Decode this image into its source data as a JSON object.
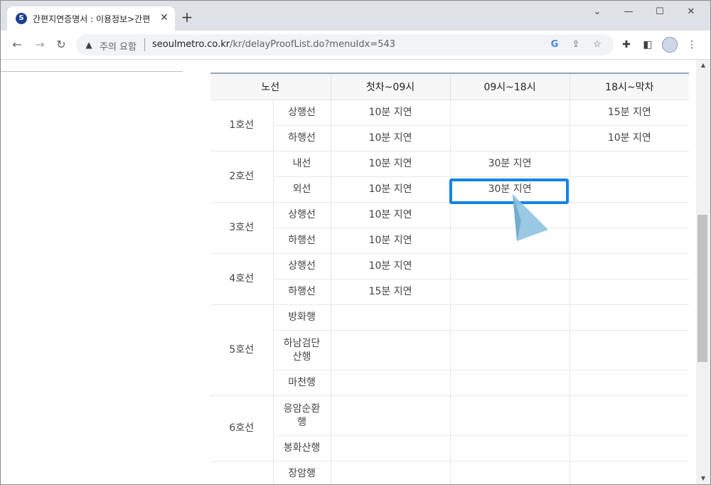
{
  "browser": {
    "tab_title": "간편지연증명서 : 이용정보>간편",
    "favicon_letter": "S",
    "new_tab": "+",
    "close_tab": "✕",
    "window_min": "—",
    "window_max": "☐",
    "window_close": "✕",
    "window_menu": "⌄",
    "security_warning": "주의 요함",
    "url_host": "seoulmetro.co.kr",
    "url_path": "/kr/delayProofList.do?menuIdx=543"
  },
  "table": {
    "headers": [
      "노선",
      "첫차~09시",
      "09시~18시",
      "18시~막차"
    ],
    "groups": [
      {
        "line": "1호선",
        "rows": [
          {
            "dir": "상행선",
            "c1": "10분 지연",
            "c2": "",
            "c3": "15분 지연"
          },
          {
            "dir": "하행선",
            "c1": "10분 지연",
            "c2": "",
            "c3": "10분 지연"
          }
        ]
      },
      {
        "line": "2호선",
        "rows": [
          {
            "dir": "내선",
            "c1": "10분 지연",
            "c2": "30분 지연",
            "c3": ""
          },
          {
            "dir": "외선",
            "c1": "10분 지연",
            "c2": "30분 지연",
            "c3": ""
          }
        ]
      },
      {
        "line": "3호선",
        "rows": [
          {
            "dir": "상행선",
            "c1": "10분 지연",
            "c2": "",
            "c3": ""
          },
          {
            "dir": "하행선",
            "c1": "10분 지연",
            "c2": "",
            "c3": ""
          }
        ]
      },
      {
        "line": "4호선",
        "rows": [
          {
            "dir": "상행선",
            "c1": "10분 지연",
            "c2": "",
            "c3": ""
          },
          {
            "dir": "하행선",
            "c1": "15분 지연",
            "c2": "",
            "c3": ""
          }
        ]
      },
      {
        "line": "5호선",
        "rows": [
          {
            "dir": "방화행",
            "c1": "",
            "c2": "",
            "c3": ""
          },
          {
            "dir": "하남검단\n산행",
            "c1": "",
            "c2": "",
            "c3": ""
          },
          {
            "dir": "마천행",
            "c1": "",
            "c2": "",
            "c3": ""
          }
        ]
      },
      {
        "line": "6호선",
        "rows": [
          {
            "dir": "응암순환\n행",
            "c1": "",
            "c2": "",
            "c3": ""
          },
          {
            "dir": "봉화산행",
            "c1": "",
            "c2": "",
            "c3": ""
          }
        ]
      },
      {
        "line": "",
        "rows": [
          {
            "dir": "장암행",
            "c1": "",
            "c2": "",
            "c3": ""
          }
        ]
      }
    ]
  },
  "colors": {
    "highlight": "#1382e8",
    "pointer": "#8ec3e0",
    "table_top_border": "#8fa7bd"
  }
}
